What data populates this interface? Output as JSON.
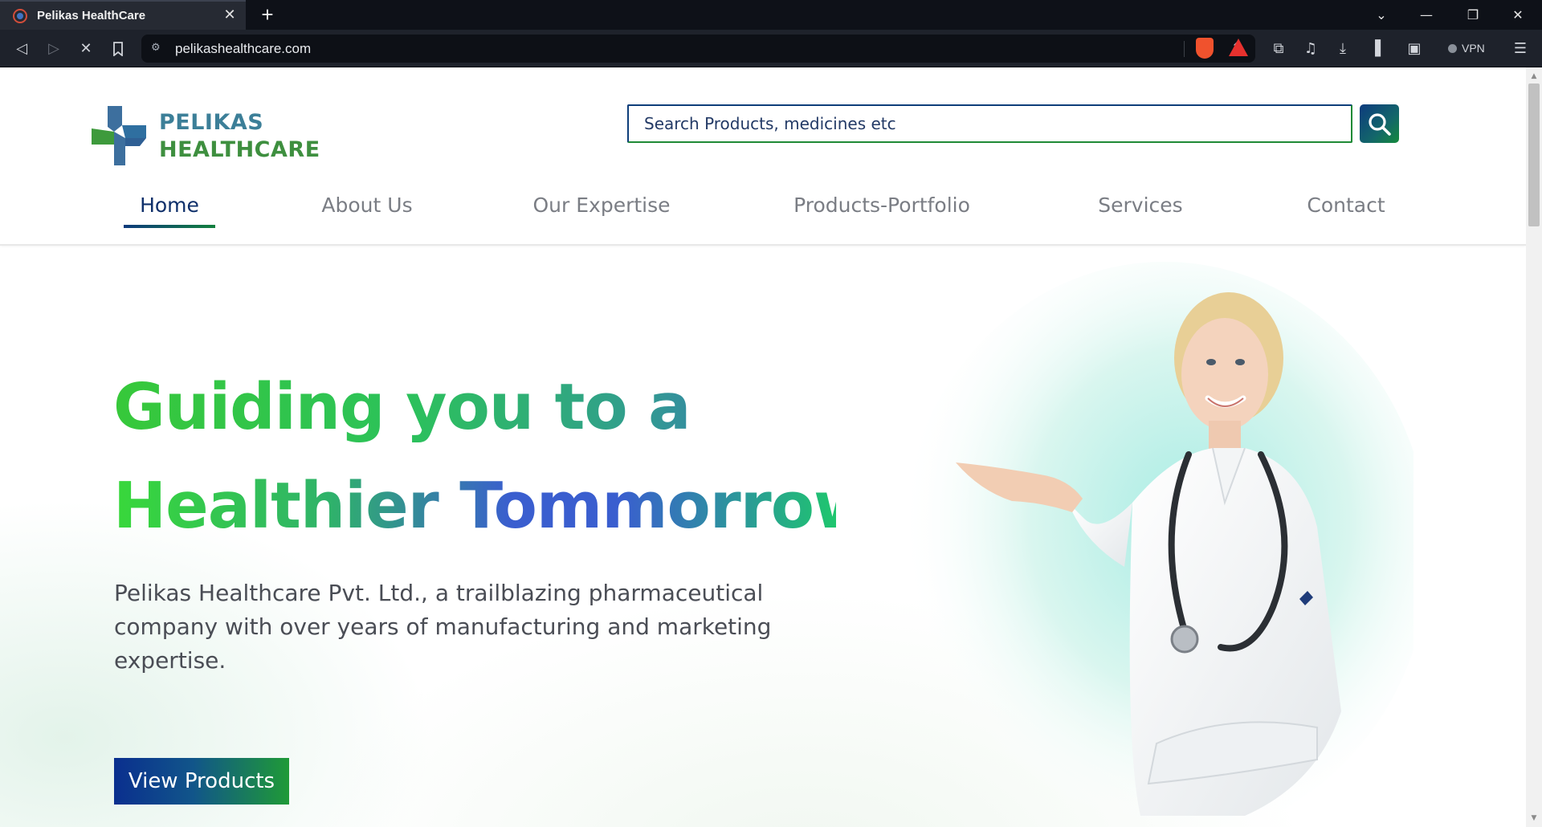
{
  "browser": {
    "tab_title": "Pelikas HealthCare",
    "tab_close": "✕",
    "new_tab": "+",
    "url": "pelikashealthcare.com",
    "vpn_label": "VPN"
  },
  "header": {
    "logo": {
      "line1": "PELIKAS",
      "line2": "HEALTHCARE"
    },
    "search": {
      "placeholder": "Search Products, medicines etc"
    }
  },
  "nav": {
    "items": [
      {
        "label": "Home",
        "active": true
      },
      {
        "label": "About Us",
        "active": false
      },
      {
        "label": "Our Expertise",
        "active": false
      },
      {
        "label": "Products-Portfolio",
        "active": false
      },
      {
        "label": "Services",
        "active": false
      },
      {
        "label": "Contact",
        "active": false
      }
    ]
  },
  "hero": {
    "title_line1_part1": "Guiding you to a",
    "title_line2": "Healthier Tommorrow",
    "description": "Pelikas Healthcare Pvt. Ltd., a trailblazing pharmaceutical company with over years of manufacturing and marketing expertise.",
    "cta_label": "View Products"
  },
  "colors": {
    "brand_navy": "#0e3e7a",
    "brand_green": "#1f8a36",
    "hero_green": "#37c83a",
    "hero_blue": "#3a5ecf"
  },
  "icons": {
    "search_button": "search-icon",
    "browser_back": "back-arrow-icon",
    "browser_forward": "forward-arrow-icon",
    "browser_stop": "stop-loading-icon",
    "bookmark": "bookmark-icon",
    "site_settings": "site-settings-icon",
    "share": "share-icon",
    "extensions": "puzzle-icon",
    "media": "music-note-icon",
    "downloads": "download-icon",
    "sidebar": "sidebar-icon",
    "wallet": "wallet-icon",
    "menu": "hamburger-menu-icon"
  }
}
